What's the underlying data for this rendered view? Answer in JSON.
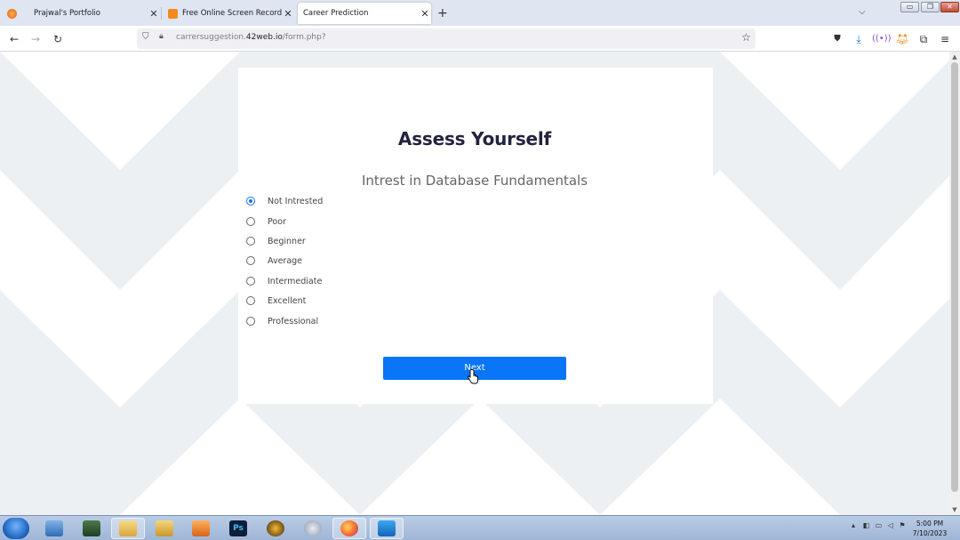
{
  "browser": {
    "tabs": [
      {
        "label": "Prajwal's Portfolio",
        "active": false
      },
      {
        "label": "Free Online Screen Recorder &",
        "active": false
      },
      {
        "label": "Career Prediction",
        "active": true
      }
    ],
    "url_path_prefix": "carrersuggestion.",
    "url_host": "42web.io",
    "url_path_suffix": "/form.php?"
  },
  "page": {
    "title": "Assess Yourself",
    "question": "Intrest in Database Fundamentals",
    "options": [
      {
        "label": "Not Intrested",
        "checked": true
      },
      {
        "label": "Poor",
        "checked": false
      },
      {
        "label": "Beginner",
        "checked": false
      },
      {
        "label": "Average",
        "checked": false
      },
      {
        "label": "Intermediate",
        "checked": false
      },
      {
        "label": "Excellent",
        "checked": false
      },
      {
        "label": "Professional",
        "checked": false
      }
    ],
    "next_label": "Next"
  },
  "taskbar": {
    "apps": [
      {
        "icon": "control-panel-icon",
        "open": false
      },
      {
        "icon": "computer-icon",
        "open": false
      },
      {
        "icon": "file-explorer-icon",
        "open": true
      },
      {
        "icon": "folder-notes-icon",
        "open": false
      },
      {
        "icon": "media-player-icon",
        "open": false
      },
      {
        "icon": "photoshop-icon",
        "label": "Ps",
        "open": false
      },
      {
        "icon": "fl-studio-icon",
        "open": false
      },
      {
        "icon": "snipping-tool-icon",
        "open": false
      },
      {
        "icon": "firefox-icon",
        "open": true
      },
      {
        "icon": "vscode-icon",
        "open": true
      }
    ],
    "time": "5:00 PM",
    "date": "7/10/2023"
  },
  "colors": {
    "accent": "#0a75f6",
    "title": "#23233f",
    "bg_chevron": "#edf0f2"
  }
}
